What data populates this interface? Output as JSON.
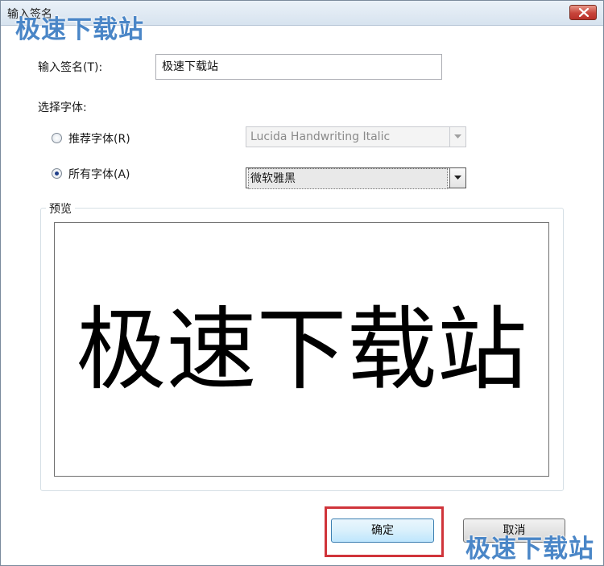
{
  "window": {
    "title": "输入签名"
  },
  "watermark": {
    "text": "极速下载站"
  },
  "signature": {
    "label": "输入签名(T):",
    "value": "极速下载站"
  },
  "font_choice": {
    "label": "选择字体:",
    "recommended": {
      "label": "推荐字体(R)",
      "selected_value": "Lucida Handwriting Italic",
      "checked": false
    },
    "all": {
      "label": "所有字体(A)",
      "selected_value": "微软雅黑",
      "checked": true
    }
  },
  "preview": {
    "title": "预览",
    "text": "极速下载站"
  },
  "buttons": {
    "ok": "确定",
    "cancel": "取消"
  },
  "colors": {
    "highlight": "#d0343a",
    "watermark": "#4a86c7"
  }
}
